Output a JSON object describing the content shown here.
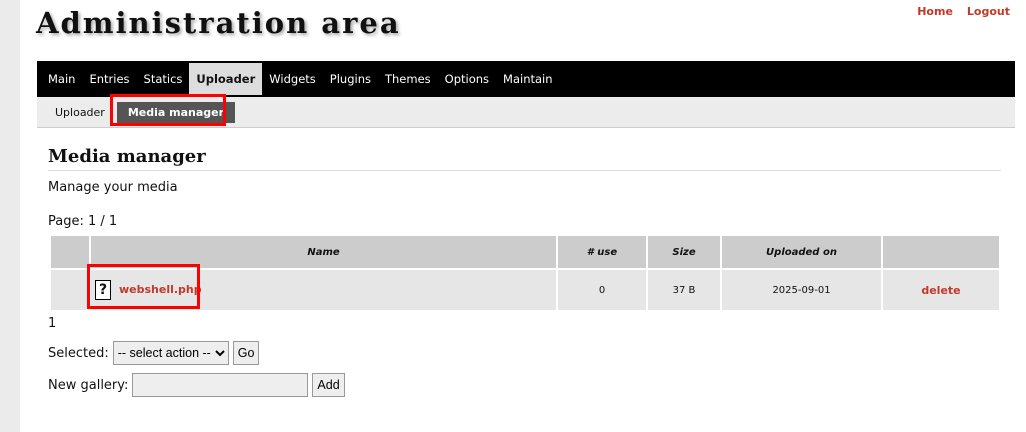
{
  "header": {
    "title": "Administration area",
    "links": [
      "Home",
      "Logout"
    ]
  },
  "nav": {
    "items": [
      "Main",
      "Entries",
      "Statics",
      "Uploader",
      "Widgets",
      "Plugins",
      "Themes",
      "Options",
      "Maintain"
    ],
    "active": "Uploader"
  },
  "subnav": {
    "items": [
      "Uploader",
      "Media manager"
    ]
  },
  "page": {
    "title": "Media manager",
    "description": "Manage your media",
    "pagination": "Page: 1 / 1",
    "page_links": "1"
  },
  "table": {
    "headers": [
      "",
      "Name",
      "# use",
      "Size",
      "Uploaded on",
      ""
    ],
    "rows": [
      {
        "name": "webshell.php",
        "uses": "0",
        "size": "37 B",
        "uploaded": "2025-09-01",
        "action": "delete"
      }
    ]
  },
  "form": {
    "selected_label": "Selected:",
    "select_value": "-- select action --",
    "go": "Go",
    "gallery_label": "New gallery:",
    "gallery_value": "",
    "add": "Add"
  }
}
